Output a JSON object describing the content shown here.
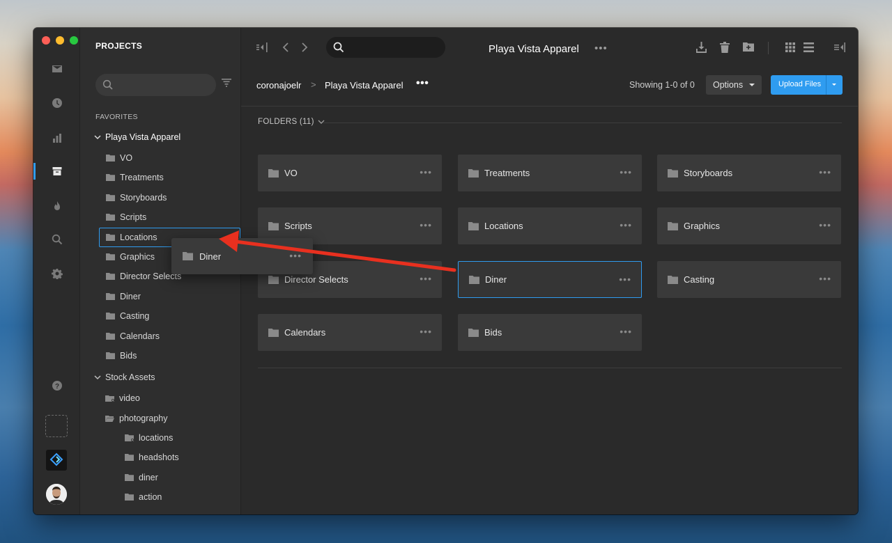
{
  "sidebar": {
    "title": "PROJECTS",
    "search_placeholder": "",
    "favorites_label": "FAVORITES",
    "project_name": "Playa Vista Apparel",
    "project_folders": [
      "VO",
      "Treatments",
      "Storyboards",
      "Scripts",
      "Locations",
      "Graphics",
      "Director Selects",
      "Diner",
      "Casting",
      "Calendars",
      "Bids"
    ],
    "stock_label": "Stock Assets",
    "stock_children": [
      "video",
      "photography"
    ],
    "photo_children": [
      "locations",
      "headshots",
      "diner",
      "action"
    ]
  },
  "rail": {
    "icons": [
      "inbox-icon",
      "clock-icon",
      "stats-icon",
      "projects-icon",
      "fire-icon",
      "search-icon",
      "settings-icon"
    ],
    "active": "projects-icon"
  },
  "toolbar": {
    "search_placeholder": "",
    "project_title": "Playa Vista Apparel",
    "dots": "•••"
  },
  "breadcrumb": {
    "user": "coronajoelr",
    "sep": ">",
    "project": "Playa Vista Apparel",
    "dots": "•••"
  },
  "showing": "Showing 1-0 of 0",
  "options_label": "Options",
  "upload_label": "Upload Files",
  "folders_header": "FOLDERS (11)",
  "folders": [
    "VO",
    "Treatments",
    "Storyboards",
    "Scripts",
    "Locations",
    "Graphics",
    "Director Selects",
    "Diner",
    "Casting",
    "Calendars",
    "Bids"
  ],
  "selected_folder": "Diner",
  "drag_ghost": {
    "label": "Diner",
    "dots": "•••"
  },
  "card_dots": "•••",
  "colors": {
    "accent": "#2f9cf0",
    "arrow": "#e8301f",
    "window_bg": "#2a2a2a"
  }
}
